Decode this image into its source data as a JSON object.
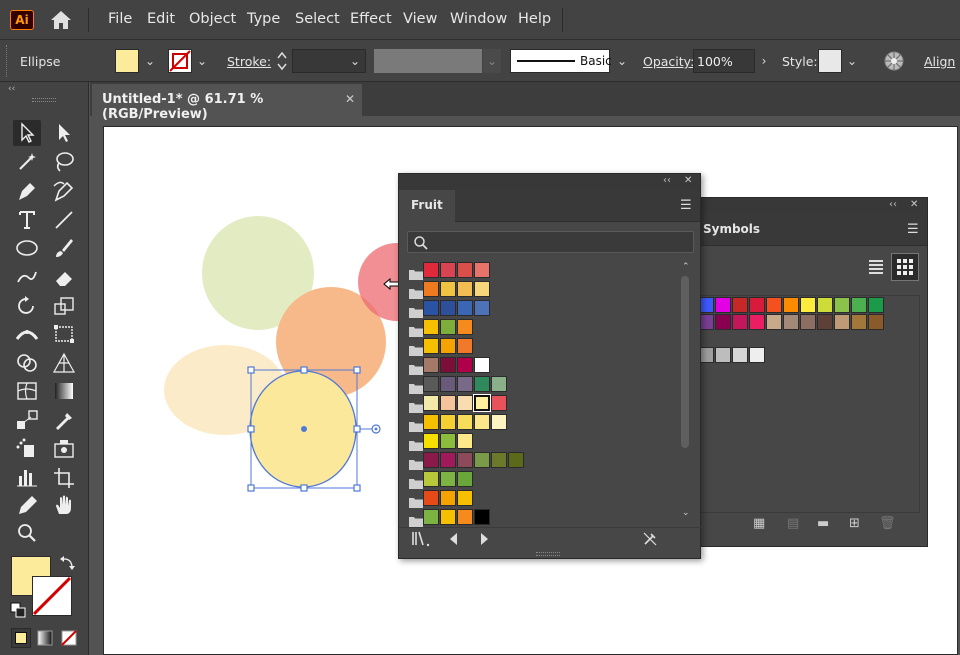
{
  "app": {
    "logo_text": "Ai",
    "menu": [
      "File",
      "Edit",
      "Object",
      "Type",
      "Select",
      "Effect",
      "View",
      "Window",
      "Help"
    ]
  },
  "control_bar": {
    "object_type": "Ellipse",
    "fill_color": "#FCEB9A",
    "stroke_label": "Stroke:",
    "brush_label": "Basic",
    "opacity_label": "Opacity:",
    "opacity_value": "100%",
    "style_label": "Style:",
    "align_label": "Align"
  },
  "document_tab": {
    "title": "Untitled-1* @ 61.71 % (RGB/Preview)",
    "close": "✕"
  },
  "toolbar": {
    "fill_swatch": "#FCEB9A",
    "tools": [
      "selection-tool",
      "direct-selection-tool",
      "magic-wand-tool",
      "lasso-tool",
      "pen-tool",
      "curvature-tool",
      "type-tool",
      "line-tool",
      "ellipse-tool",
      "paintbrush-tool",
      "shaper-tool",
      "eraser-tool",
      "rotate-tool",
      "scale-tool",
      "width-tool",
      "free-transform-tool",
      "shape-builder-tool",
      "perspective-grid-tool",
      "mesh-tool",
      "gradient-tool",
      "eyedropper-tool",
      "blend-tool",
      "symbol-sprayer-tool",
      "symbol-tool",
      "column-graph-tool",
      "artboard-tool",
      "slice-tool",
      "hand-tool",
      "zoom-tool"
    ]
  },
  "fruit_panel": {
    "tab_label": "Fruit",
    "collapse": "‹‹",
    "close": "✕",
    "groups": [
      [
        "#e02a3c",
        "#d94452",
        "#d9504b",
        "#e8736a"
      ],
      [
        "#f07a1f",
        "#f0c341",
        "#f3bd53",
        "#f6d77a"
      ],
      [
        "#2a53a3",
        "#2e4f9a",
        "#3a66b3",
        "#4e72b8"
      ],
      [
        "#f6c000",
        "#7dad3a",
        "#f58a1f"
      ],
      [
        "#f6c000",
        "#f5a300",
        "#f07a2a"
      ],
      [
        "#a5796a",
        "#7b0f3a",
        "#b0004a",
        "#ffffff"
      ],
      [
        "#5a5a5a",
        "#6a5a7a",
        "#7a6a8a",
        "#2e8a5a",
        "#8ab08a"
      ],
      [
        "#f3e9a8",
        "#f6c49a",
        "#f9dcb0",
        "#fdf1a0",
        "#e8525a"
      ],
      [
        "#f6c000",
        "#f5d033",
        "#f7dd5a",
        "#fbe68a",
        "#fdf3c0"
      ],
      [
        "#f6e000",
        "#8cbc3c",
        "#fde98a"
      ],
      [
        "#8a1a4a",
        "#a01a5a",
        "#8c4a5a",
        "#7a9a4a",
        "#6a7a2a",
        "#5a6a1a"
      ],
      [
        "#b8c83a",
        "#7cb342",
        "#6aa63a"
      ],
      [
        "#e64a19",
        "#f5a300",
        "#f6c000"
      ],
      [
        "#7cb342",
        "#f6c000",
        "#f58a1f",
        "#000000"
      ]
    ]
  },
  "symbols_panel": {
    "tab_label": "Symbols",
    "collapse": "‹‹",
    "close": "✕",
    "rows": [
      [
        "#3d5afe",
        "#e400e4",
        "#c62828",
        "#d81b3a",
        "#f4511e",
        "#fb8c00",
        "#ffeb3b",
        "#cddc39",
        "#8bc34a",
        "#4caf50",
        "#1b9a4a"
      ],
      [
        "#7a3e96",
        "#8a0050",
        "#c2185b",
        "#e91e63",
        "#c8a98a",
        "#a38a78",
        "#8d6e63",
        "#5d4037",
        "#bf9a77",
        "#a1783a",
        "#8a5a2a"
      ],
      [
        "#9e9e9e",
        "#bdbdbd",
        "#d6d6d6",
        "#eeeeee"
      ]
    ]
  }
}
